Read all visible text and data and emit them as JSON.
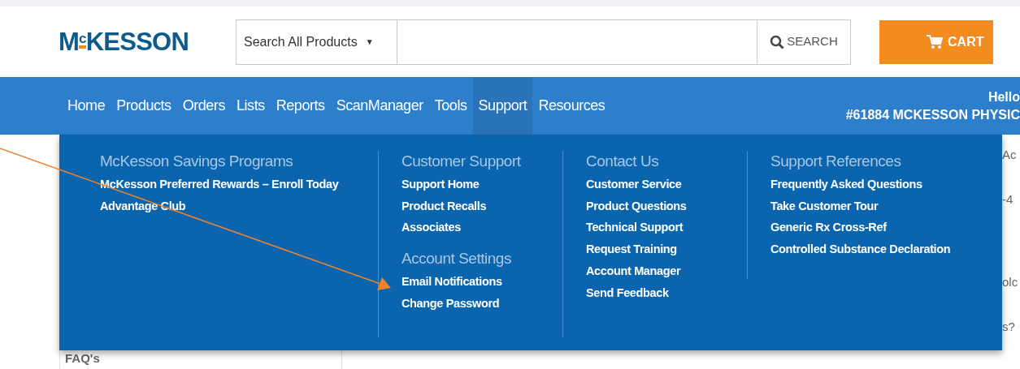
{
  "header": {
    "logo": "M$^{c}$KESSON",
    "search": {
      "scope": "Search All Products",
      "scope_caret": "▼",
      "button": "SEARCH"
    },
    "cart": "CART"
  },
  "nav": {
    "items": [
      {
        "label": "Home",
        "selected": false
      },
      {
        "label": "Products",
        "selected": false
      },
      {
        "label": "Orders",
        "selected": false
      },
      {
        "label": "Lists",
        "selected": false
      },
      {
        "label": "Reports",
        "selected": false
      },
      {
        "label": "ScanManager",
        "selected": false
      },
      {
        "label": "Tools",
        "selected": false
      },
      {
        "label": "Support",
        "selected": true
      },
      {
        "label": "Resources",
        "selected": false
      }
    ],
    "user": {
      "greeting": "Hello",
      "account": "#61884 MCKESSON PHYSIC"
    }
  },
  "support_menu": {
    "columns": [
      {
        "sections": [
          {
            "heading": "McKesson Savings Programs",
            "links": [
              "McKesson Preferred Rewards – Enroll Today",
              "Advantage Club"
            ]
          }
        ]
      },
      {
        "sections": [
          {
            "heading": "Customer Support",
            "links": [
              "Support Home",
              "Product Recalls",
              "Associates"
            ]
          },
          {
            "heading": "Account Settings",
            "links": [
              "Email Notifications",
              "Change Password"
            ]
          }
        ]
      },
      {
        "sections": [
          {
            "heading": "Contact Us",
            "links": [
              "Customer Service",
              "Product Questions",
              "Technical Support",
              "Request Training",
              "Account Manager",
              "Send Feedback"
            ]
          }
        ]
      },
      {
        "sections": [
          {
            "heading": "Support References",
            "links": [
              "Frequently Asked Questions",
              "Take Customer Tour",
              "Generic Rx Cross-Ref",
              "Controlled Substance Declaration"
            ]
          }
        ]
      }
    ]
  },
  "page_behind": {
    "sidebar_link": "FAQ's",
    "right_fragments": [
      "Ac",
      "-4",
      "olc",
      "s?"
    ]
  }
}
